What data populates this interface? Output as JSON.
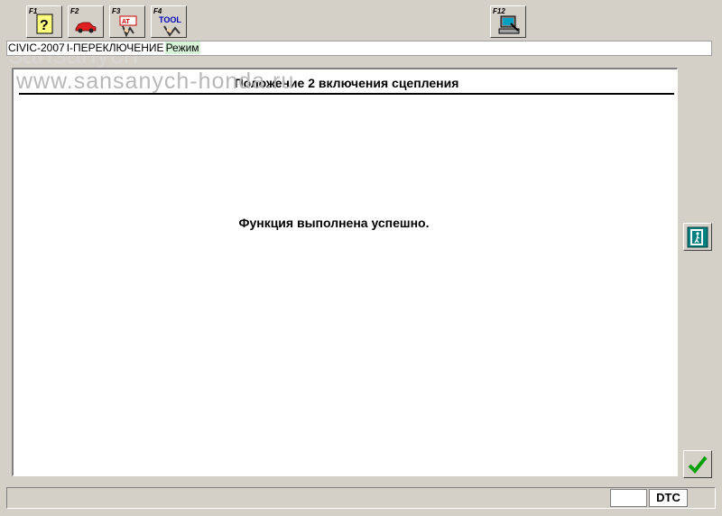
{
  "toolbar": {
    "buttons": [
      {
        "key": "F1",
        "icon": "help-icon"
      },
      {
        "key": "F2",
        "icon": "car-icon"
      },
      {
        "key": "F3",
        "icon": "mode-icon"
      },
      {
        "key": "F4",
        "icon": "tool-icon"
      },
      {
        "key": "F12",
        "icon": "computer-icon"
      }
    ],
    "tool_text": "TOOL"
  },
  "breadcrumb": {
    "model": "CIVIC-2007",
    "section": "I-ПЕРЕКЛЮЧЕНИЕ",
    "mode": "Режим"
  },
  "watermark": "www.sansanych-honda.ru",
  "main": {
    "title": "Положение 2 включения сцепления",
    "message": "Функция выполнена успешно."
  },
  "status": {
    "dtc_value": "",
    "dtc_label": "DTC"
  },
  "colors": {
    "accent": "#008080",
    "check": "#00a000"
  }
}
